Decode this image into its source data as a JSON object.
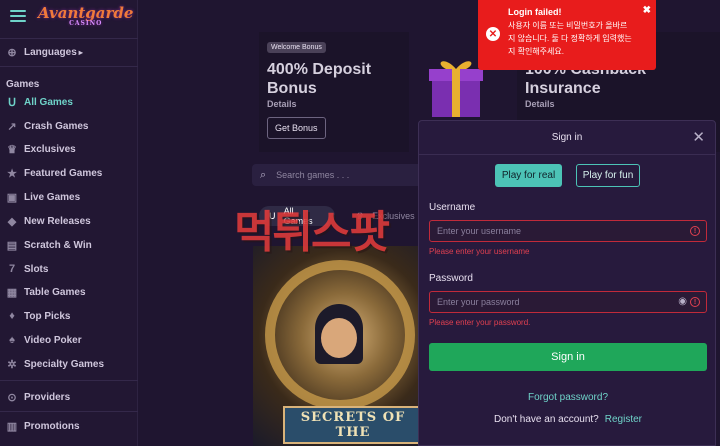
{
  "brand": {
    "logo_text": "Avantgarde",
    "logo_sub": "CASINO"
  },
  "sidebar": {
    "languages_label": "Languages",
    "games_heading": "Games",
    "items": [
      {
        "label": "All Games",
        "icon": "horseshoe-icon"
      },
      {
        "label": "Crash Games",
        "icon": "rocket-icon"
      },
      {
        "label": "Exclusives",
        "icon": "crown-icon"
      },
      {
        "label": "Featured Games",
        "icon": "star-icon"
      },
      {
        "label": "Live Games",
        "icon": "live-icon"
      },
      {
        "label": "New Releases",
        "icon": "new-icon"
      },
      {
        "label": "Scratch & Win",
        "icon": "scratch-icon"
      },
      {
        "label": "Slots",
        "icon": "seven-icon"
      },
      {
        "label": "Table Games",
        "icon": "table-icon"
      },
      {
        "label": "Top Picks",
        "icon": "thumbs-up-icon"
      },
      {
        "label": "Video Poker",
        "icon": "cards-icon"
      },
      {
        "label": "Specialty Games",
        "icon": "gear-icon"
      }
    ],
    "providers_label": "Providers",
    "promotions_label": "Promotions"
  },
  "promos": [
    {
      "badge": "Welcome Bonus",
      "title": "400% Deposit Bonus",
      "details": "Details",
      "button": "Get Bonus"
    },
    {
      "title": "100% Cashback Insurance",
      "details": "Details"
    }
  ],
  "search": {
    "placeholder": "Search games . . ."
  },
  "filters": {
    "all": "All Games",
    "exclusives": "Exclusives"
  },
  "game": {
    "title": "SECRETS OF THE"
  },
  "watermark": "먹튀스팟",
  "toast": {
    "title": "Login failed!",
    "message": "사용자 이름 또는 비밀번호가 올바르지 않습니다. 둘 다 정확하게 입력했는지 확인해주세요."
  },
  "modal": {
    "title": "Sign in",
    "play_real": "Play for real",
    "play_fun": "Play for fun",
    "username_label": "Username",
    "username_placeholder": "Enter your username",
    "username_error": "Please enter your username",
    "password_label": "Password",
    "password_placeholder": "Enter your password",
    "password_error": "Please enter your password.",
    "signin_button": "Sign in",
    "forgot": "Forgot password?",
    "no_account": "Don't have an account?",
    "register": "Register"
  },
  "colors": {
    "accent": "#4cc3b6",
    "error": "#e81c1c",
    "signin": "#1fa75a"
  }
}
